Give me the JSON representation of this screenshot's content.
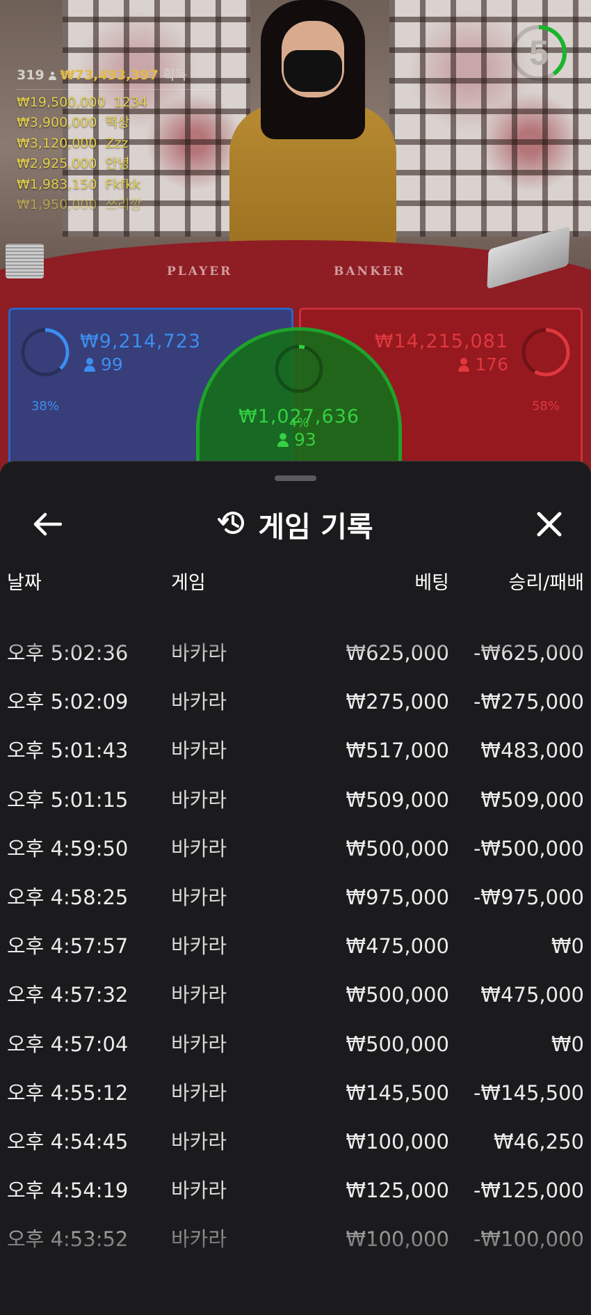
{
  "leaderboard": {
    "rank_count": "319",
    "total": "₩73,493,397",
    "total_suffix": "획득",
    "rows": [
      {
        "amount": "₩19,500,000",
        "name": "1234"
      },
      {
        "amount": "₩3,900,000",
        "name": "떡상"
      },
      {
        "amount": "₩3,120,000",
        "name": "Zzz"
      },
      {
        "amount": "₩2,925,000",
        "name": "안녕"
      },
      {
        "amount": "₩1,983,150",
        "name": "Fkfkk"
      },
      {
        "amount": "₩1,950,000",
        "name": "쓰리깡"
      }
    ]
  },
  "timer": {
    "value": "5",
    "fraction": 0.4
  },
  "table": {
    "player_word": "PLAYER",
    "banker_word": "BANKER"
  },
  "bets": {
    "player": {
      "percent": "38%",
      "fraction": 0.38,
      "amount": "₩9,214,723",
      "players": "99",
      "color": "#3d8ef0"
    },
    "tie": {
      "percent": "4%",
      "fraction": 0.04,
      "amount": "₩1,027,636",
      "players": "93",
      "color": "#35d043"
    },
    "banker": {
      "percent": "58%",
      "fraction": 0.58,
      "amount": "₩14,215,081",
      "players": "176",
      "color": "#e0383f"
    }
  },
  "sheet": {
    "title": "게임 기록",
    "columns": {
      "date": "날짜",
      "game": "게임",
      "bet": "베팅",
      "result": "승리/패배"
    },
    "rows": [
      {
        "date": "오후 5:02:36",
        "game": "바카라",
        "bet": "₩625,000",
        "result": "-₩625,000"
      },
      {
        "date": "오후 5:02:09",
        "game": "바카라",
        "bet": "₩275,000",
        "result": "-₩275,000"
      },
      {
        "date": "오후 5:01:43",
        "game": "바카라",
        "bet": "₩517,000",
        "result": "₩483,000"
      },
      {
        "date": "오후 5:01:15",
        "game": "바카라",
        "bet": "₩509,000",
        "result": "₩509,000"
      },
      {
        "date": "오후 4:59:50",
        "game": "바카라",
        "bet": "₩500,000",
        "result": "-₩500,000"
      },
      {
        "date": "오후 4:58:25",
        "game": "바카라",
        "bet": "₩975,000",
        "result": "-₩975,000"
      },
      {
        "date": "오후 4:57:57",
        "game": "바카라",
        "bet": "₩475,000",
        "result": "₩0"
      },
      {
        "date": "오후 4:57:32",
        "game": "바카라",
        "bet": "₩500,000",
        "result": "₩475,000"
      },
      {
        "date": "오후 4:57:04",
        "game": "바카라",
        "bet": "₩500,000",
        "result": "₩0"
      },
      {
        "date": "오후 4:55:12",
        "game": "바카라",
        "bet": "₩145,500",
        "result": "-₩145,500"
      },
      {
        "date": "오후 4:54:45",
        "game": "바카라",
        "bet": "₩100,000",
        "result": "₩46,250"
      },
      {
        "date": "오후 4:54:19",
        "game": "바카라",
        "bet": "₩125,000",
        "result": "-₩125,000"
      },
      {
        "date": "오후 4:53:52",
        "game": "바카라",
        "bet": "₩100,000",
        "result": "-₩100,000"
      }
    ]
  }
}
